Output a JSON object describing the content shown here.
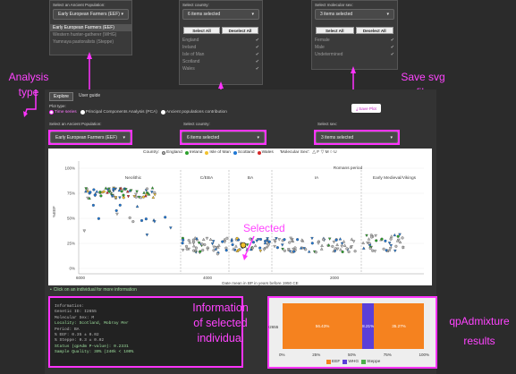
{
  "colors": {
    "magenta": "#ff33ff",
    "eef": "#f5821f",
    "whg": "#5b3fd8",
    "steppe": "#4daf4a",
    "background": "#2b2b2b"
  },
  "pop_dropdown": {
    "label": "Select an Ancient Population:",
    "value": "Early European Farmers (EEF)",
    "options": [
      "Early European Farmers (EEF)",
      "Western hunter-gatherer (WHG)",
      "Yamnaya pastoralists (Steppe)"
    ]
  },
  "country_dropdown": {
    "label": "Select country:",
    "value": "6 items selected",
    "select_all": "Select All",
    "deselect_all": "Deselect All",
    "options": [
      "England",
      "Ireland",
      "Isle of Man",
      "Scotland",
      "Wales"
    ]
  },
  "sex_dropdown": {
    "label": "Select molecular sex:",
    "value": "3 items selected",
    "select_all": "Select All",
    "deselect_all": "Deselect All",
    "options": [
      "Female",
      "Male",
      "Undetermined"
    ]
  },
  "annotations": {
    "analysis_l1": "Analysis",
    "analysis_l2": "type",
    "save_l1": "Save svg",
    "save_l2": "file",
    "selected": "Selected",
    "info_l1": "Information",
    "info_l2": "of selected",
    "info_l3": "individual",
    "qp_l1": "qpAdmixture",
    "qp_l2": "results"
  },
  "tabs": [
    "Explore",
    "User guide"
  ],
  "plot_type": {
    "label": "Plot type:",
    "options": [
      "Time series",
      "Principal Components Analysis (PCA)",
      "Ancient populations contribution"
    ]
  },
  "save_plot": "Save Plot",
  "filters": {
    "pop_label": "Select an Ancient Population:",
    "pop_value": "Early European Farmers (EEF)",
    "country_label": "Select country:",
    "country_value": "6 items selected",
    "sex_label": "Select sex:",
    "sex_value": "3 items selected"
  },
  "chart_data": {
    "type": "scatter",
    "legend_country_title": "Country:",
    "legend_countries": [
      {
        "name": "England",
        "color": "#bbbbbb"
      },
      {
        "name": "Ireland",
        "color": "#2ca02c"
      },
      {
        "name": "Isle of Man",
        "color": "#f2c22e"
      },
      {
        "name": "Scotland",
        "color": "#1f77d4"
      },
      {
        "name": "Wales",
        "color": "#d62728"
      }
    ],
    "legend_sex_title": "'Molecular Sex':",
    "legend_sex_symbols": "△ F ▽ M ○ U",
    "y_ticks": [
      "100%",
      "75%",
      "50%",
      "25%",
      "0%"
    ],
    "ylabel": "%EEF",
    "x_ticks": [
      "6000",
      "4000",
      "2000"
    ],
    "xlabel": "Date mean in BP in years before 1950 CE",
    "periods": [
      "Neolithic",
      "C/EBA",
      "BA",
      "IA",
      "Romans period",
      "Early Medieval/Vikings"
    ]
  },
  "click_hint": "Click on an individual for more information",
  "info": {
    "header": "Information:",
    "genetic_id": "Genetic ID: I2655",
    "sex": "Molecular Sex: M",
    "locality": "Locality: Scotland, Mobray Mer",
    "period": "Period: BA",
    "eef": "% EEF: 0.35 ± 0.02",
    "steppe": "% Steppe: 0.3 ± 0.02",
    "status": "Status (qpAdm P-value): 0.2331",
    "quality": "Sample Quality: 30% (240k < 100%"
  },
  "qp": {
    "row_label": "I2655",
    "segments": [
      {
        "name": "EEF",
        "value": "56.43%",
        "pct": 56.43,
        "color": "#f5821f"
      },
      {
        "name": "WHG",
        "value": "8.21%",
        "pct": 8.21,
        "color": "#5b3fd8"
      },
      {
        "name": "Steppe",
        "value": "35.27%",
        "pct": 35.27,
        "color": "#4daf4a"
      }
    ],
    "x_ticks": [
      "0%",
      "25%",
      "50%",
      "75%",
      "100%"
    ]
  }
}
